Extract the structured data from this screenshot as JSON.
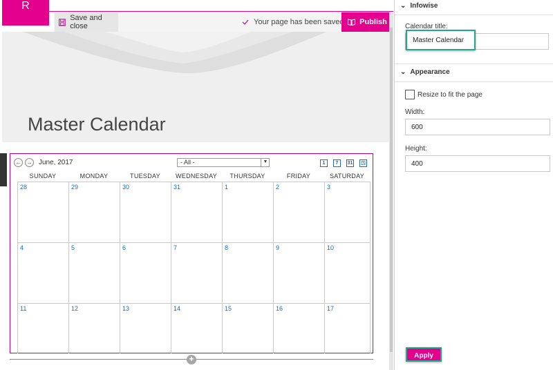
{
  "user": {
    "avatar_initial": "R"
  },
  "toolbar": {
    "save_close_label": "Save and close",
    "status_text": "Your page has been saved",
    "publish_label": "Publish"
  },
  "page": {
    "title": "Master Calendar"
  },
  "calendar": {
    "month_label": "June, 2017",
    "filter_value": "- All -",
    "view_icons": [
      "1",
      "7",
      "31",
      "◳"
    ],
    "day_headers": [
      "SUNDAY",
      "MONDAY",
      "TUESDAY",
      "WEDNESDAY",
      "THURSDAY",
      "FRIDAY",
      "SATURDAY"
    ],
    "weeks": [
      [
        "28",
        "29",
        "30",
        "31",
        "1",
        "2",
        "3"
      ],
      [
        "4",
        "5",
        "6",
        "7",
        "8",
        "9",
        "10"
      ],
      [
        "11",
        "12",
        "13",
        "14",
        "15",
        "16",
        "17"
      ]
    ]
  },
  "pane": {
    "infowise": {
      "header": "Infowise",
      "calendar_title_label": "Calendar title:",
      "calendar_title_value": "Master Calendar"
    },
    "appearance": {
      "header": "Appearance",
      "resize_label": "Resize to fit the page",
      "resize_checked": false,
      "width_label": "Width:",
      "width_value": "600",
      "height_label": "Height:",
      "height_value": "400"
    },
    "apply_label": "Apply"
  },
  "colors": {
    "accent": "#e3008c",
    "highlight": "#21a88f",
    "link": "#1a6fb0"
  },
  "icons": {
    "save": "floppy-disk-icon",
    "saved": "checkmark-icon",
    "publish": "book-icon",
    "prev": "arrow-left-icon",
    "next": "arrow-right-icon",
    "dropdown": "chevron-down-icon",
    "add": "plus-icon"
  }
}
